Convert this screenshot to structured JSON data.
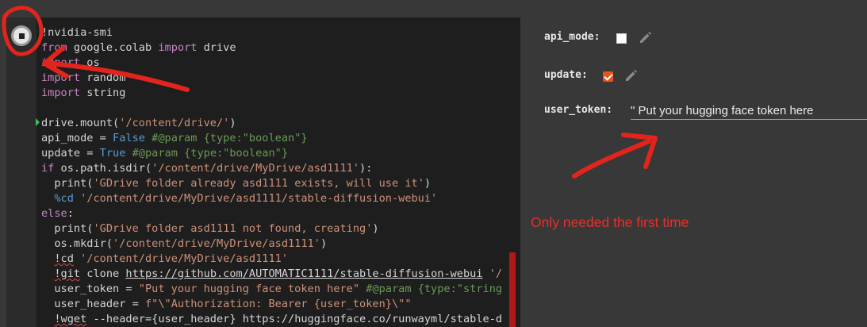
{
  "cell": {
    "run_button_label": "",
    "code_lines": [
      [
        {
          "t": "!nvidia-smi",
          "c": ""
        }
      ],
      [
        {
          "t": "from",
          "c": "kw"
        },
        {
          "t": " google.colab ",
          "c": ""
        },
        {
          "t": "import",
          "c": "kw"
        },
        {
          "t": " drive",
          "c": ""
        }
      ],
      [
        {
          "t": "import",
          "c": "kw"
        },
        {
          "t": " os",
          "c": ""
        }
      ],
      [
        {
          "t": "import",
          "c": "kw"
        },
        {
          "t": " random",
          "c": ""
        }
      ],
      [
        {
          "t": "import",
          "c": "kw"
        },
        {
          "t": " string",
          "c": ""
        }
      ],
      [
        {
          "t": "",
          "c": ""
        }
      ],
      [
        {
          "t": "drive.mount(",
          "c": ""
        },
        {
          "t": "'/content/drive/'",
          "c": "str"
        },
        {
          "t": ")",
          "c": ""
        }
      ],
      [
        {
          "t": "api_mode = ",
          "c": ""
        },
        {
          "t": "False",
          "c": "num"
        },
        {
          "t": " #@param {type:\"boolean\"}",
          "c": "com"
        }
      ],
      [
        {
          "t": "update = ",
          "c": ""
        },
        {
          "t": "True",
          "c": "num"
        },
        {
          "t": " #@param {type:\"boolean\"}",
          "c": "com"
        }
      ],
      [
        {
          "t": "if",
          "c": "kw"
        },
        {
          "t": " os.path.isdir(",
          "c": ""
        },
        {
          "t": "'/content/drive/MyDrive/asd1111'",
          "c": "str"
        },
        {
          "t": "):",
          "c": ""
        }
      ],
      [
        {
          "t": "  print(",
          "c": ""
        },
        {
          "t": "'GDrive folder already asd1111 exists, will use it'",
          "c": "str"
        },
        {
          "t": ")",
          "c": ""
        }
      ],
      [
        {
          "t": "  %cd ",
          "c": "num"
        },
        {
          "t": "'/content/drive/MyDrive/asd1111/stable-diffusion-webui'",
          "c": "str"
        }
      ],
      [
        {
          "t": "else",
          "c": "kw"
        },
        {
          "t": ":",
          "c": ""
        }
      ],
      [
        {
          "t": "  print(",
          "c": ""
        },
        {
          "t": "'GDrive folder asd1111 not found, creating'",
          "c": "str"
        },
        {
          "t": ")",
          "c": ""
        }
      ],
      [
        {
          "t": "  os.mkdir(",
          "c": ""
        },
        {
          "t": "'/content/drive/MyDrive/asd1111'",
          "c": "str"
        },
        {
          "t": ")",
          "c": ""
        }
      ],
      [
        {
          "t": "  ",
          "c": ""
        },
        {
          "t": "!cd",
          "c": "sq-err"
        },
        {
          "t": " ",
          "c": ""
        },
        {
          "t": "'/content/drive/MyDrive/asd1111'",
          "c": "str"
        }
      ],
      [
        {
          "t": "  ",
          "c": ""
        },
        {
          "t": "!git",
          "c": "sq-err"
        },
        {
          "t": " clone ",
          "c": ""
        },
        {
          "t": "https://github.com/AUTOMATIC1111/stable-diffusion-webui",
          "c": "uline"
        },
        {
          "t": " '/",
          "c": "str"
        }
      ],
      [
        {
          "t": "  user_token = ",
          "c": ""
        },
        {
          "t": "\"Put your hugging face token here\"",
          "c": "str"
        },
        {
          "t": " #@param {type:\"string",
          "c": "com"
        }
      ],
      [
        {
          "t": "  user_header = ",
          "c": ""
        },
        {
          "t": "f\"\\\"Authorization: Bearer {user_token}\\\"\"",
          "c": "str"
        }
      ],
      [
        {
          "t": "  ",
          "c": ""
        },
        {
          "t": "!wget",
          "c": "sq-err"
        },
        {
          "t": " --header={user_header} https://huggingface.co/runwayml/stable-d",
          "c": ""
        }
      ]
    ]
  },
  "form": {
    "api_mode": {
      "label": "api_mode:",
      "checked": false
    },
    "update": {
      "label": "update:",
      "checked": true
    },
    "user_token": {
      "label": "user_token:",
      "value": "\" Put your hugging face token here"
    }
  },
  "annotation": {
    "note": "Only needed the first time",
    "color": "#e5312a"
  },
  "icons": [
    "stop-icon",
    "pencil-icon"
  ],
  "colors": {
    "accent_checkbox": "#e8541c",
    "code_bg": "#1e1e1e",
    "panel_bg": "#383838"
  }
}
